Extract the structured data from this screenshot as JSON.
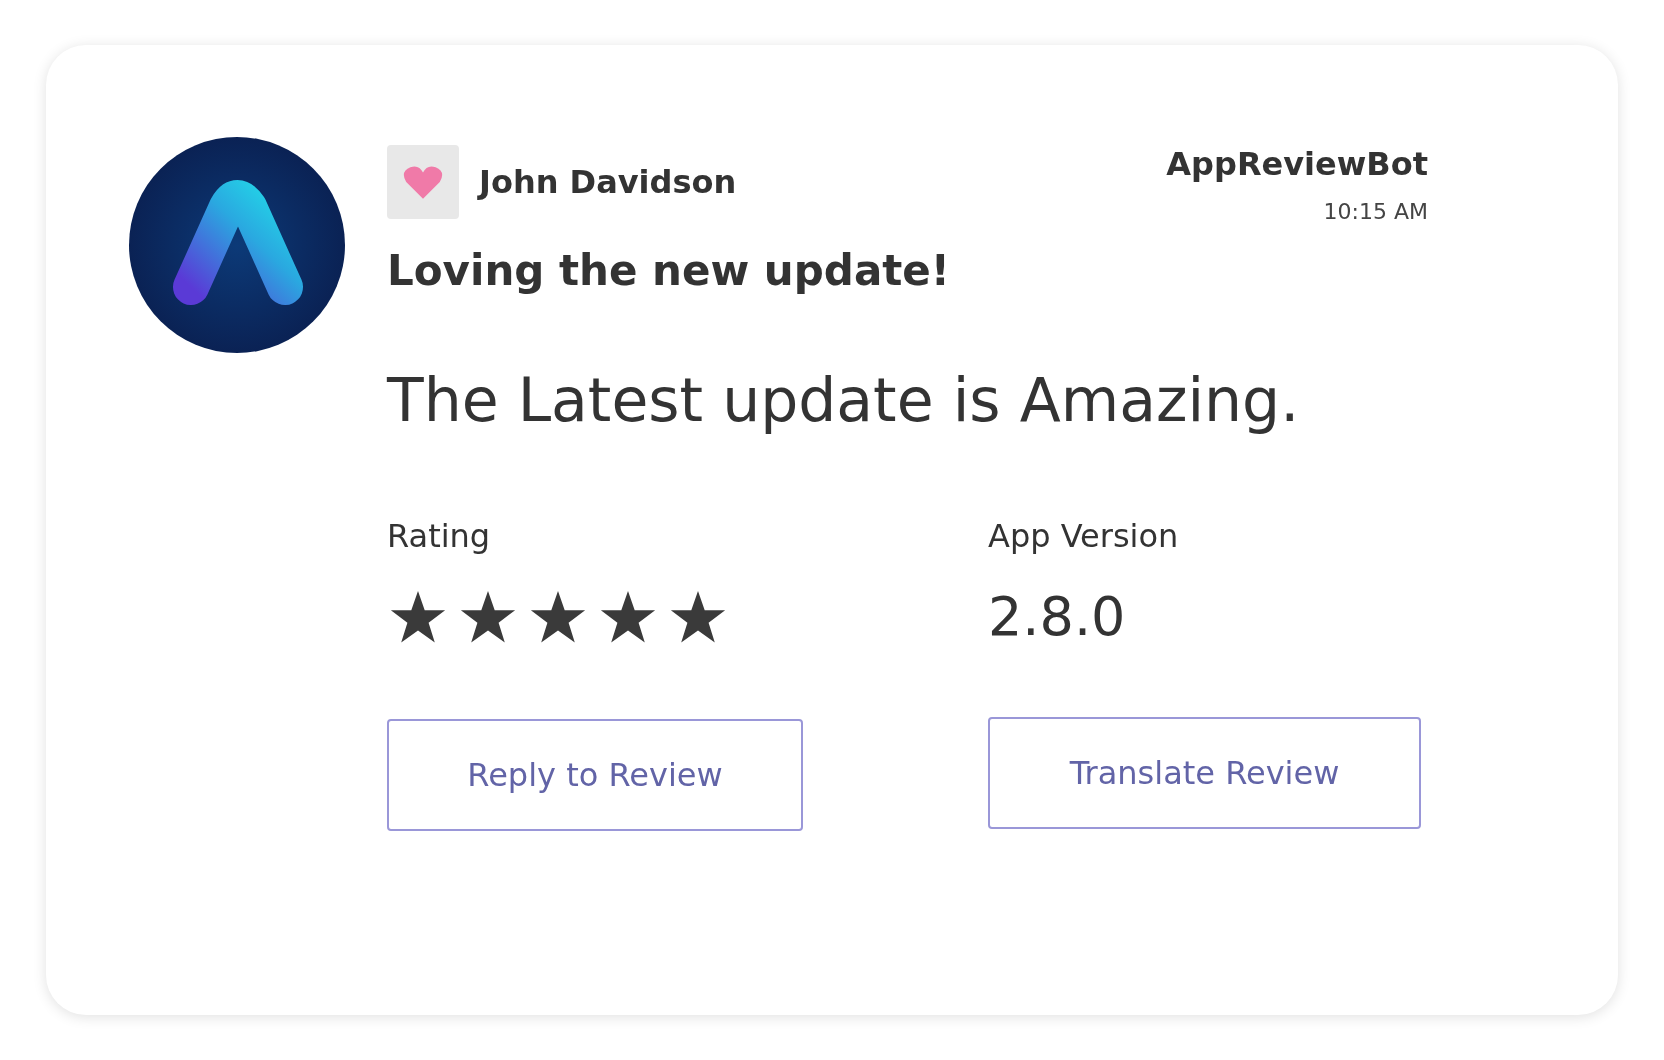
{
  "author": {
    "name": "John Davidson"
  },
  "bot": {
    "name": "AppReviewBot",
    "time": "10:15 AM"
  },
  "review": {
    "title": "Loving the new update!",
    "body": "The Latest update is Amazing."
  },
  "rating": {
    "label": "Rating",
    "stars": 5
  },
  "version": {
    "label": "App Version",
    "value": "2.8.0"
  },
  "buttons": [
    "Reply to Review",
    "Translate Review"
  ]
}
